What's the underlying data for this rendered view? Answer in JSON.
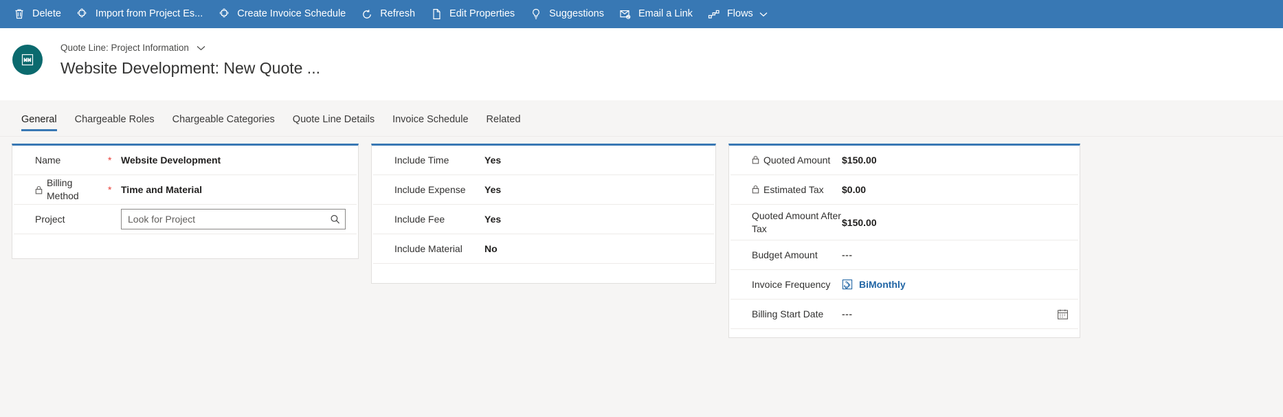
{
  "commandbar": {
    "background": "#3878b4",
    "buttons": [
      {
        "label": "Delete",
        "icon": "trash-icon",
        "caret": false
      },
      {
        "label": "Import from Project Es...",
        "icon": "puzzle-icon",
        "caret": false
      },
      {
        "label": "Create Invoice Schedule",
        "icon": "puzzle-icon",
        "caret": false
      },
      {
        "label": "Refresh",
        "icon": "refresh-icon",
        "caret": false
      },
      {
        "label": "Edit Properties",
        "icon": "edit-properties-icon",
        "caret": false
      },
      {
        "label": "Suggestions",
        "icon": "lightbulb-icon",
        "caret": false
      },
      {
        "label": "Email a Link",
        "icon": "email-link-icon",
        "caret": false
      },
      {
        "label": "Flows",
        "icon": "flows-icon",
        "caret": true
      }
    ]
  },
  "record_header": {
    "entity_icon": "quote-line-icon",
    "entity_icon_color": "#0b6a6e",
    "breadcrumb": "Quote Line: Project Information",
    "title": "Website Development: New Quote ..."
  },
  "tabs": {
    "accent_color": "#3878b4",
    "items": [
      {
        "label": "General",
        "active": true
      },
      {
        "label": "Chargeable Roles",
        "active": false
      },
      {
        "label": "Chargeable Categories",
        "active": false
      },
      {
        "label": "Quote Line Details",
        "active": false
      },
      {
        "label": "Invoice Schedule",
        "active": false
      },
      {
        "label": "Related",
        "active": false
      }
    ]
  },
  "form": {
    "section_accent": "#3878b4",
    "left": {
      "fields": [
        {
          "label": "Name",
          "locked": false,
          "required": true,
          "value": "Website Development",
          "type": "text"
        },
        {
          "label": "Billing Method",
          "locked": true,
          "required": true,
          "value": "Time and Material",
          "type": "text"
        },
        {
          "label": "Project",
          "locked": false,
          "required": false,
          "value": "",
          "placeholder": "Look for Project",
          "type": "lookup",
          "icon": "search-icon"
        }
      ]
    },
    "middle": {
      "fields": [
        {
          "label": "Include Time",
          "locked": false,
          "required": false,
          "value": "Yes",
          "type": "text"
        },
        {
          "label": "Include Expense",
          "locked": false,
          "required": false,
          "value": "Yes",
          "type": "text"
        },
        {
          "label": "Include Fee",
          "locked": false,
          "required": false,
          "value": "Yes",
          "type": "text"
        },
        {
          "label": "Include Material",
          "locked": false,
          "required": false,
          "value": "No",
          "type": "text"
        }
      ]
    },
    "right": {
      "fields": [
        {
          "label": "Quoted Amount",
          "locked": true,
          "required": false,
          "value": "$150.00",
          "type": "text"
        },
        {
          "label": "Estimated Tax",
          "locked": true,
          "required": false,
          "value": "$0.00",
          "type": "text"
        },
        {
          "label": "Quoted Amount After Tax",
          "locked": false,
          "required": false,
          "value": "$150.00",
          "type": "text"
        },
        {
          "label": "Budget Amount",
          "locked": false,
          "required": false,
          "value": "---",
          "type": "empty"
        },
        {
          "label": "Invoice Frequency",
          "locked": false,
          "required": false,
          "value": "BiMonthly",
          "type": "link",
          "icon": "record-chip-icon",
          "link_color": "#2266a5"
        },
        {
          "label": "Billing Start Date",
          "locked": false,
          "required": false,
          "value": "---",
          "type": "date",
          "icon": "calendar-icon"
        }
      ]
    }
  }
}
